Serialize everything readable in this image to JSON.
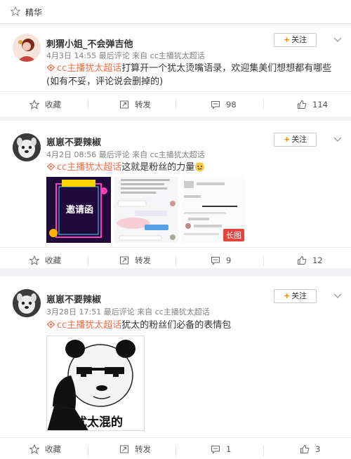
{
  "topbar": {
    "label": "精华"
  },
  "posts": [
    {
      "username": "刺猬小姐_不会弹吉他",
      "meta": "4月3日 14:55 最后评论 来自 cc主播犹太超话",
      "follow_label": "关注",
      "topic": "cc主播犹太超话",
      "text_line1": "打算开一个犹太烫嘴语录，欢迎集美们想想都有哪些",
      "text_line2": "(如有不妥，评论说会删掉的)",
      "actions": {
        "favorite": "收藏",
        "repost": "转发",
        "comments": "98",
        "likes": "114"
      }
    },
    {
      "username": "崽崽不要辣椒",
      "meta": "4月2日 08:56 最后评论 来自 cc主播犹太超话",
      "follow_label": "关注",
      "topic": "cc主播犹太超话",
      "text_line1": "这就是粉丝的力量",
      "thumb1_text": "邀请函",
      "thumb3_badge": "长图",
      "actions": {
        "favorite": "收藏",
        "repost": "转发",
        "comments": "9",
        "likes": "12"
      }
    },
    {
      "username": "崽崽不要辣椒",
      "meta": "3月28日 17:51 最后评论 来自 cc主播犹太超话",
      "follow_label": "关注",
      "topic": "cc主播犹太超话",
      "text_line1": "犹太的粉丝们必备的表情包",
      "meme_caption": "我和犹太混的",
      "actions": {
        "favorite": "收藏",
        "repost": "转发",
        "comments": "1",
        "likes": "3"
      }
    }
  ],
  "colors": {
    "accent": "#ff8200",
    "topic": "#eb7350",
    "background": "#f2f2f5"
  }
}
